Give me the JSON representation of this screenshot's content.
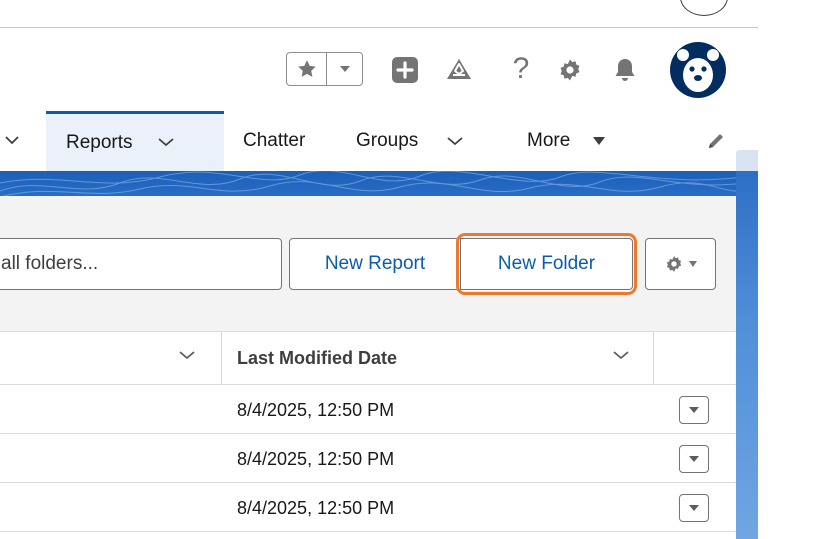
{
  "header": {
    "icons": [
      "star-icon",
      "chevron-down-icon",
      "add-icon",
      "trailhead-icon",
      "help-icon",
      "setup-gear-icon",
      "notification-bell-icon",
      "avatar"
    ]
  },
  "nav": {
    "items": [
      {
        "label": "Reports",
        "active": true
      },
      {
        "label": "Chatter"
      },
      {
        "label": "Groups"
      },
      {
        "label": "More"
      }
    ]
  },
  "toolbar": {
    "search_placeholder": "all folders...",
    "new_report": "New Report",
    "new_folder": "New Folder"
  },
  "table": {
    "columns": [
      "",
      "Last Modified Date"
    ],
    "rows": [
      {
        "last_modified": "8/4/2025, 12:50 PM"
      },
      {
        "last_modified": "8/4/2025, 12:50 PM"
      },
      {
        "last_modified": "8/4/2025, 12:50 PM"
      }
    ]
  },
  "colors": {
    "brand": "#0b5cab",
    "highlight": "#f0782c"
  }
}
